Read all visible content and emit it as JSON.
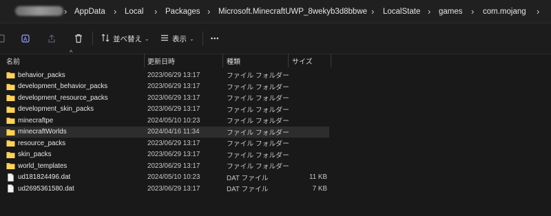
{
  "breadcrumb": {
    "segments": [
      "AppData",
      "Local",
      "Packages",
      "Microsoft.MinecraftUWP_8wekyb3d8bbwe",
      "LocalState",
      "games",
      "com.mojang"
    ]
  },
  "toolbar": {
    "sort_label": "並べ替え",
    "view_label": "表示",
    "more_label": "•••"
  },
  "columns": {
    "name": "名前",
    "date": "更新日時",
    "type": "種類",
    "size": "サイズ"
  },
  "files": [
    {
      "name": "behavior_packs",
      "date": "2023/06/29 13:17",
      "type": "ファイル フォルダー",
      "size": "",
      "kind": "folder",
      "selected": false
    },
    {
      "name": "development_behavior_packs",
      "date": "2023/06/29 13:17",
      "type": "ファイル フォルダー",
      "size": "",
      "kind": "folder",
      "selected": false
    },
    {
      "name": "development_resource_packs",
      "date": "2023/06/29 13:17",
      "type": "ファイル フォルダー",
      "size": "",
      "kind": "folder",
      "selected": false
    },
    {
      "name": "development_skin_packs",
      "date": "2023/06/29 13:17",
      "type": "ファイル フォルダー",
      "size": "",
      "kind": "folder",
      "selected": false
    },
    {
      "name": "minecraftpe",
      "date": "2024/05/10 10:23",
      "type": "ファイル フォルダー",
      "size": "",
      "kind": "folder",
      "selected": false
    },
    {
      "name": "minecraftWorlds",
      "date": "2024/04/16 11:34",
      "type": "ファイル フォルダー",
      "size": "",
      "kind": "folder",
      "selected": true
    },
    {
      "name": "resource_packs",
      "date": "2023/06/29 13:17",
      "type": "ファイル フォルダー",
      "size": "",
      "kind": "folder",
      "selected": false
    },
    {
      "name": "skin_packs",
      "date": "2023/06/29 13:17",
      "type": "ファイル フォルダー",
      "size": "",
      "kind": "folder",
      "selected": false
    },
    {
      "name": "world_templates",
      "date": "2023/06/29 13:17",
      "type": "ファイル フォルダー",
      "size": "",
      "kind": "folder",
      "selected": false
    },
    {
      "name": "ud181824496.dat",
      "date": "2024/05/10 10:23",
      "type": "DAT ファイル",
      "size": "11 KB",
      "kind": "file",
      "selected": false
    },
    {
      "name": "ud2695361580.dat",
      "date": "2023/06/29 13:17",
      "type": "DAT ファイル",
      "size": "7 KB",
      "kind": "file",
      "selected": false
    }
  ],
  "colors": {
    "folder": "#f5c542",
    "selected_row": "#2d2d2d",
    "accent_icon": "#9aa3ff"
  }
}
